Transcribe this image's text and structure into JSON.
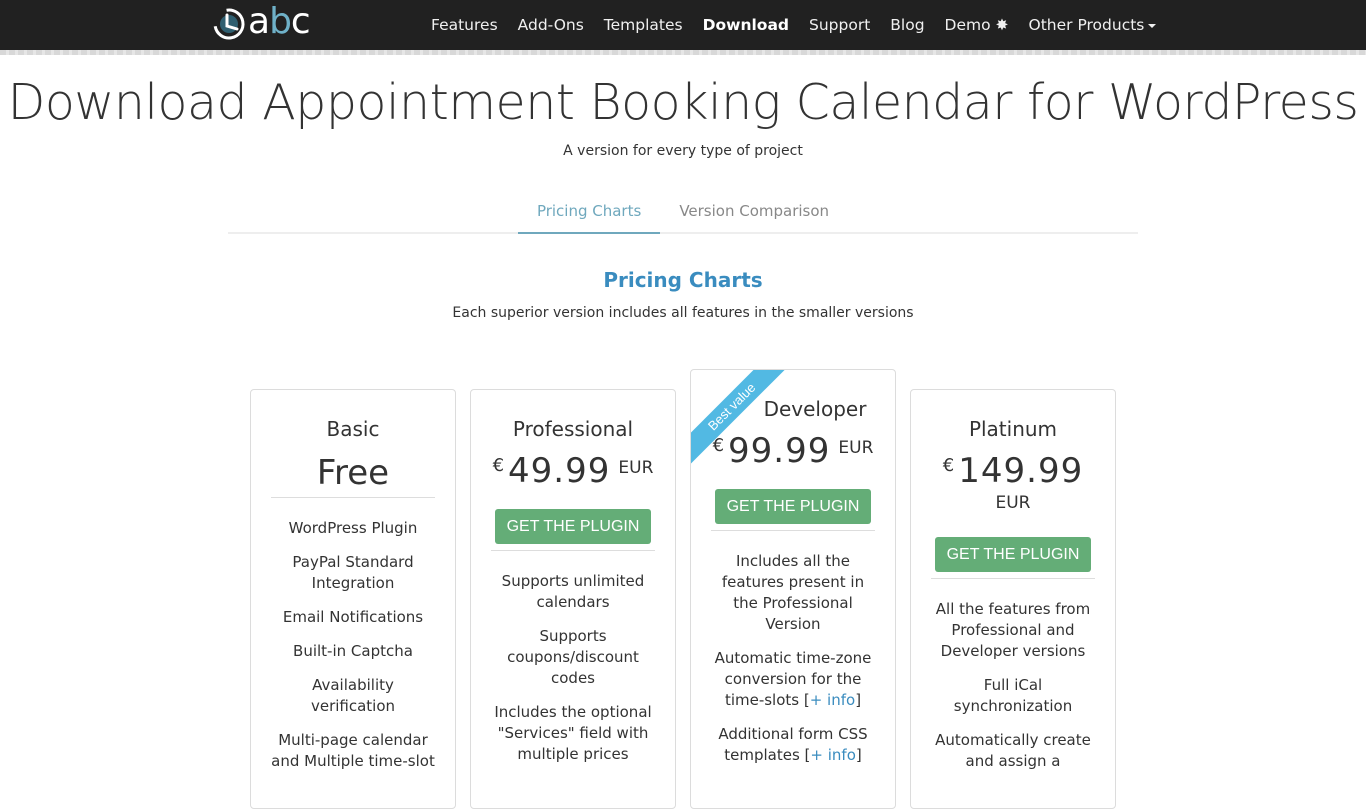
{
  "nav": {
    "logo": {
      "part1": "a",
      "part2": "b",
      "part3": "c"
    },
    "items": [
      {
        "label": "Features",
        "active": false
      },
      {
        "label": "Add-Ons",
        "active": false
      },
      {
        "label": "Templates",
        "active": false
      },
      {
        "label": "Download",
        "active": true
      },
      {
        "label": "Support",
        "active": false
      },
      {
        "label": "Blog",
        "active": false
      },
      {
        "label": "Demo ✸",
        "active": false
      },
      {
        "label": "Other Products",
        "active": false,
        "dropdown": true
      }
    ]
  },
  "header": {
    "title": "Download Appointment Booking Calendar for WordPress",
    "subtitle": "A version for every type of project"
  },
  "tabs": [
    {
      "label": "Pricing Charts",
      "active": true
    },
    {
      "label": "Version Comparison",
      "active": false
    }
  ],
  "section": {
    "title": "Pricing Charts",
    "subtitle": "Each superior version includes all features in the smaller versions"
  },
  "plans": [
    {
      "name": "Basic",
      "price": "Free",
      "features": [
        "WordPress Plugin",
        "PayPal Standard Integration",
        "Email Notifications",
        "Built-in Captcha",
        "Availability verification",
        "Multi-page calendar and Multiple time-slot"
      ]
    },
    {
      "name": "Professional",
      "currency": "€",
      "price": "49.99",
      "unit": "EUR",
      "button": "GET THE PLUGIN",
      "features": [
        "Supports unlimited calendars",
        "Supports coupons/discount codes",
        "Includes the optional \"Services\" field with multiple prices"
      ]
    },
    {
      "name": "Developer",
      "ribbon": "Best value",
      "currency": "€",
      "price": "99.99",
      "unit": "EUR",
      "button": "GET THE PLUGIN",
      "features": [
        "Includes all the features present in the Professional Version",
        "Automatic time-zone conversion for the time-slots [",
        "Additional form CSS templates ["
      ],
      "info_link": "+ info",
      "info_close": "]"
    },
    {
      "name": "Platinum",
      "currency": "€",
      "price": "149.99",
      "unit": "EUR",
      "button": "GET THE PLUGIN",
      "features": [
        "All the features from Professional and Developer versions",
        "Full iCal synchronization",
        "Automatically create and assign a"
      ]
    }
  ],
  "colors": {
    "navbar": "#212121",
    "accent": "#3a8cbf",
    "tab_active": "#6fa8bd",
    "button": "#64ad77",
    "ribbon": "#52b9e3"
  }
}
